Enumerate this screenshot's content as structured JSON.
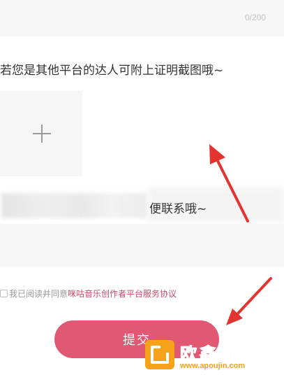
{
  "feedback": {
    "char_counter": "0/200"
  },
  "proof": {
    "hint": "若您是其他平台的达人可附上证明截图哦~",
    "upload_icon": "plus-icon"
  },
  "contact": {
    "hint_visible_tail": "便联系哦~"
  },
  "agreement": {
    "prefix": "我已阅读并同意",
    "link": "咪咕音乐创作者平台服务协议"
  },
  "submit": {
    "label": "提交"
  },
  "watermark": {
    "title": "欧鑫软件园",
    "url": "www.apoujin.com"
  },
  "colors": {
    "accent": "#e15873",
    "link": "#c64d6a",
    "arrow": "#e3342f",
    "watermark": "#f7a21b"
  }
}
